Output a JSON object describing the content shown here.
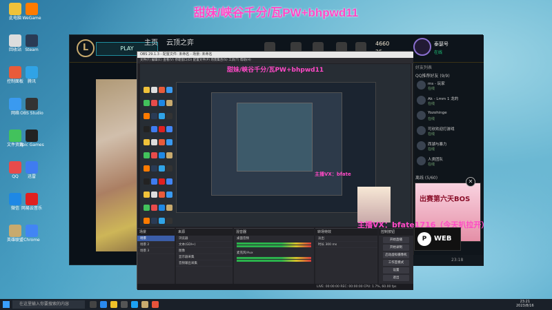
{
  "overlay": {
    "title": "甜妹/峡谷千分/瓦PW+bhpwd11"
  },
  "obs": {
    "window_title": "OBS 29.1.3 - 配置文件: 未命名 - 场景: 未命名",
    "menu": "文件(F)  编辑(E)  查看(V)  停靠窗口(D)  配置文件(P)  场景集合(S)  工具(T)  帮助(H)",
    "preview_subtitle": "甜妹/峡谷千分/瓦PW+bhpwd11",
    "nested_vx": "主播VX：bfate",
    "docks": {
      "scenes_title": "场景",
      "scenes": [
        "场景",
        "场景 2",
        "场景 3"
      ],
      "sources_title": "来源",
      "sources": [
        "浏览器",
        "文本(GDI+)",
        "图像",
        "显示器采集",
        "音频输出采集"
      ],
      "mixer_title": "混音器",
      "mixer_items": [
        "桌面音频",
        "麦克风/Aux"
      ],
      "transitions_title": "转场特效",
      "transition_name": "淡出",
      "duration_label": "时长",
      "duration_value": "300 ms",
      "controls_title": "控制按钮",
      "controls": [
        "开始直播",
        "开始录制",
        "启动虚拟摄像机",
        "工作室模式",
        "设置",
        "退出"
      ]
    },
    "status": "LIVE: 00:00:00   REC: 00:00:00   CPU: 1.7%, 60.00 fps"
  },
  "lol_client": {
    "play_label": "PLAY",
    "nav_home": "主页",
    "nav_tft": "云顶之弈",
    "rp": "4660",
    "be": "25",
    "player_name": "泰瑟号",
    "player_status": "在线",
    "friends_header": "好友列表",
    "friends_group": "QQ推荐好友 (9/9)",
    "friends": [
      {
        "name": "ms - 玩家",
        "status": "在线"
      },
      {
        "name": "Ak - Lmm 1 龙的",
        "status": "在线"
      },
      {
        "name": "Yozohinge",
        "status": "在线"
      },
      {
        "name": "可欣欢迎打游戏",
        "status": "在线"
      },
      {
        "name": "西湖与暴力",
        "status": "在线"
      },
      {
        "name": "人类团队",
        "status": "在线"
      }
    ],
    "offline_group": "离线 (5/60)",
    "ad_text": "出赛第六天BOS",
    "bottom_time": "23:18"
  },
  "streamer_vx": "主播VX：bfate1716（今天扒拉开）",
  "web_logo": {
    "letter": "P",
    "text": "WEB"
  },
  "desktop_icons": [
    "此电脑",
    "回收站",
    "控制面板",
    "网络",
    "文件资源",
    "QQ",
    "微信",
    "英雄联盟",
    "WeGame",
    "Steam",
    "腾讯",
    "OBS Studio",
    "Epic Games",
    "迅雷",
    "网易云音乐",
    "Chrome"
  ],
  "taskbar": {
    "search_placeholder": "在这里输入你要搜索的内容",
    "time": "23:21",
    "date": "2023/8/16"
  }
}
